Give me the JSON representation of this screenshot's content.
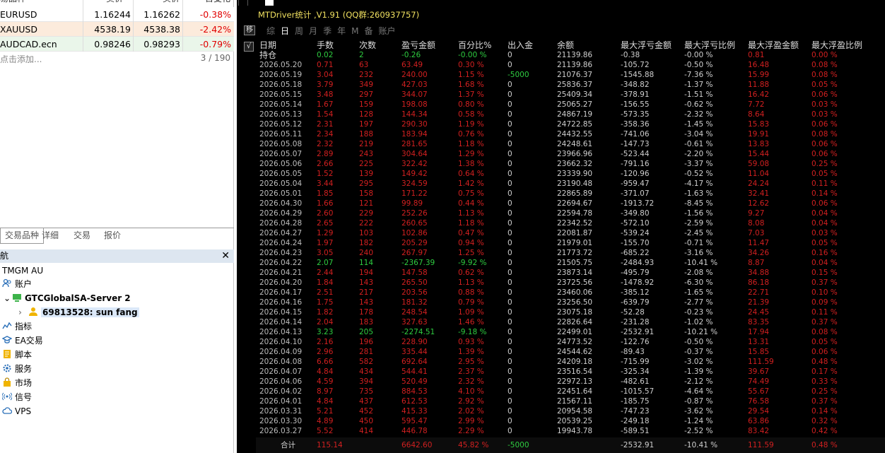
{
  "market_watch": {
    "rows": [
      {
        "symbol": "EURUSD",
        "bid": "1.16244",
        "ask": "1.16262",
        "change": "-0.38%"
      },
      {
        "symbol": "XAUUSD",
        "bid": "4538.19",
        "ask": "4538.38",
        "change": "-2.42%"
      },
      {
        "symbol": "AUDCAD.ecn",
        "bid": "0.98246",
        "ask": "0.98293",
        "change": "-0.79%"
      }
    ],
    "add_label": "点击添加...",
    "count": "3 / 190"
  },
  "tabs": [
    "交易品种",
    "详细",
    "交易",
    "报价"
  ],
  "navigator": {
    "title": "航",
    "broker": "TMGM AU",
    "accounts_label": "账户",
    "server": "GTCGlobalSA-Server 2",
    "account": "69813528: sun fang",
    "items": [
      "指标",
      "EA交易",
      "脚本",
      "服务",
      "市场",
      "信号",
      "VPS"
    ]
  },
  "panel": {
    "title": "MTDriver统计 ,V1.91 (QQ群:260937757)",
    "toolbar": [
      "综",
      "日",
      "周",
      "月",
      "季",
      "年",
      "M",
      "备",
      "账户"
    ],
    "active_index": 1,
    "side_buttons": [
      "移",
      "√"
    ],
    "headers": [
      "日期",
      "手数",
      "次数",
      "盈亏金额",
      "百分比%",
      "出入金",
      "余额",
      "最大浮亏金额",
      "最大浮亏比例",
      "最大浮盈金额",
      "最大浮盈比例"
    ],
    "holding": [
      "持仓",
      "0.02",
      "2",
      "-0.26",
      "-0.00 %",
      "0",
      "21139.86",
      "-0.38",
      "-0.00 %",
      "0.81",
      "0.00 %"
    ],
    "rows": [
      [
        "2026.05.20",
        "0.71",
        "63",
        "63.49",
        "0.30 %",
        "0",
        "21139.86",
        "-105.72",
        "-0.50 %",
        "16.48",
        "0.08 %"
      ],
      [
        "2026.05.19",
        "3.04",
        "232",
        "240.00",
        "1.15 %",
        "-5000",
        "21076.37",
        "-1545.88",
        "-7.36 %",
        "15.99",
        "0.08 %"
      ],
      [
        "2026.05.18",
        "3.79",
        "349",
        "427.03",
        "1.68 %",
        "0",
        "25836.37",
        "-348.82",
        "-1.37 %",
        "11.88",
        "0.05 %"
      ],
      [
        "2026.05.15",
        "3.48",
        "297",
        "344.07",
        "1.37 %",
        "0",
        "25409.34",
        "-378.91",
        "-1.51 %",
        "16.42",
        "0.06 %"
      ],
      [
        "2026.05.14",
        "1.67",
        "159",
        "198.08",
        "0.80 %",
        "0",
        "25065.27",
        "-156.55",
        "-0.62 %",
        "7.72",
        "0.03 %"
      ],
      [
        "2026.05.13",
        "1.54",
        "128",
        "144.34",
        "0.58 %",
        "0",
        "24867.19",
        "-573.35",
        "-2.32 %",
        "8.64",
        "0.03 %"
      ],
      [
        "2026.05.12",
        "2.31",
        "197",
        "290.30",
        "1.19 %",
        "0",
        "24722.85",
        "-358.36",
        "-1.45 %",
        "15.83",
        "0.06 %"
      ],
      [
        "2026.05.11",
        "2.34",
        "188",
        "183.94",
        "0.76 %",
        "0",
        "24432.55",
        "-741.06",
        "-3.04 %",
        "19.91",
        "0.08 %"
      ],
      [
        "2026.05.08",
        "2.32",
        "219",
        "281.65",
        "1.18 %",
        "0",
        "24248.61",
        "-147.73",
        "-0.61 %",
        "13.83",
        "0.06 %"
      ],
      [
        "2026.05.07",
        "2.89",
        "243",
        "304.64",
        "1.29 %",
        "0",
        "23966.96",
        "-523.44",
        "-2.20 %",
        "15.44",
        "0.06 %"
      ],
      [
        "2026.05.06",
        "2.66",
        "225",
        "322.42",
        "1.38 %",
        "0",
        "23662.32",
        "-791.16",
        "-3.37 %",
        "59.08",
        "0.25 %"
      ],
      [
        "2026.05.05",
        "1.52",
        "139",
        "149.42",
        "0.64 %",
        "0",
        "23339.90",
        "-120.96",
        "-0.52 %",
        "11.04",
        "0.05 %"
      ],
      [
        "2026.05.04",
        "3.44",
        "295",
        "324.59",
        "1.42 %",
        "0",
        "23190.48",
        "-959.47",
        "-4.17 %",
        "24.24",
        "0.11 %"
      ],
      [
        "2026.05.01",
        "1.85",
        "158",
        "171.22",
        "0.75 %",
        "0",
        "22865.89",
        "-371.07",
        "-1.63 %",
        "32.41",
        "0.14 %"
      ],
      [
        "2026.04.30",
        "1.66",
        "121",
        "99.89",
        "0.44 %",
        "0",
        "22694.67",
        "-1913.72",
        "-8.45 %",
        "12.62",
        "0.06 %"
      ],
      [
        "2026.04.29",
        "2.60",
        "229",
        "252.26",
        "1.13 %",
        "0",
        "22594.78",
        "-349.80",
        "-1.56 %",
        "9.27",
        "0.04 %"
      ],
      [
        "2026.04.28",
        "2.65",
        "222",
        "260.65",
        "1.18 %",
        "0",
        "22342.52",
        "-572.10",
        "-2.59 %",
        "8.08",
        "0.04 %"
      ],
      [
        "2026.04.27",
        "1.29",
        "103",
        "102.86",
        "0.47 %",
        "0",
        "22081.87",
        "-539.24",
        "-2.45 %",
        "7.03",
        "0.03 %"
      ],
      [
        "2026.04.24",
        "1.97",
        "182",
        "205.29",
        "0.94 %",
        "0",
        "21979.01",
        "-155.70",
        "-0.71 %",
        "11.47",
        "0.05 %"
      ],
      [
        "2026.04.23",
        "3.05",
        "240",
        "267.97",
        "1.25 %",
        "0",
        "21773.72",
        "-685.22",
        "-3.16 %",
        "34.26",
        "0.16 %"
      ],
      [
        "2026.04.22",
        "2.07",
        "114",
        "-2367.39",
        "-9.92 %",
        "0",
        "21505.75",
        "-2484.93",
        "-10.41 %",
        "8.87",
        "0.04 %"
      ],
      [
        "2026.04.21",
        "2.44",
        "194",
        "147.58",
        "0.62 %",
        "0",
        "23873.14",
        "-495.79",
        "-2.08 %",
        "34.88",
        "0.15 %"
      ],
      [
        "2026.04.20",
        "1.84",
        "143",
        "265.50",
        "1.13 %",
        "0",
        "23725.56",
        "-1478.92",
        "-6.30 %",
        "86.18",
        "0.37 %"
      ],
      [
        "2026.04.17",
        "2.51",
        "217",
        "203.56",
        "0.88 %",
        "0",
        "23460.06",
        "-385.12",
        "-1.65 %",
        "22.71",
        "0.10 %"
      ],
      [
        "2026.04.16",
        "1.75",
        "143",
        "181.32",
        "0.79 %",
        "0",
        "23256.50",
        "-639.79",
        "-2.77 %",
        "21.39",
        "0.09 %"
      ],
      [
        "2026.04.15",
        "1.82",
        "178",
        "248.54",
        "1.09 %",
        "0",
        "23075.18",
        "-52.28",
        "-0.23 %",
        "24.45",
        "0.11 %"
      ],
      [
        "2026.04.14",
        "2.04",
        "183",
        "327.63",
        "1.46 %",
        "0",
        "22826.64",
        "-231.28",
        "-1.02 %",
        "83.35",
        "0.37 %"
      ],
      [
        "2026.04.13",
        "3.23",
        "205",
        "-2274.51",
        "-9.18 %",
        "0",
        "22499.01",
        "-2532.91",
        "-10.21 %",
        "17.94",
        "0.08 %"
      ],
      [
        "2026.04.10",
        "2.16",
        "196",
        "228.90",
        "0.93 %",
        "0",
        "24773.52",
        "-122.76",
        "-0.50 %",
        "13.31",
        "0.05 %"
      ],
      [
        "2026.04.09",
        "2.96",
        "281",
        "335.44",
        "1.39 %",
        "0",
        "24544.62",
        "-89.43",
        "-0.37 %",
        "15.85",
        "0.06 %"
      ],
      [
        "2026.04.08",
        "6.66",
        "582",
        "692.64",
        "2.95 %",
        "0",
        "24209.18",
        "-715.99",
        "-3.02 %",
        "111.59",
        "0.48 %"
      ],
      [
        "2026.04.07",
        "4.84",
        "434",
        "544.41",
        "2.37 %",
        "0",
        "23516.54",
        "-325.34",
        "-1.39 %",
        "39.67",
        "0.17 %"
      ],
      [
        "2026.04.06",
        "4.59",
        "394",
        "520.49",
        "2.32 %",
        "0",
        "22972.13",
        "-482.61",
        "-2.12 %",
        "74.49",
        "0.33 %"
      ],
      [
        "2026.04.02",
        "8.97",
        "735",
        "884.53",
        "4.10 %",
        "0",
        "22451.64",
        "-1015.57",
        "-4.64 %",
        "55.67",
        "0.25 %"
      ],
      [
        "2026.04.01",
        "4.84",
        "437",
        "612.53",
        "2.92 %",
        "0",
        "21567.11",
        "-185.75",
        "-0.87 %",
        "76.58",
        "0.37 %"
      ],
      [
        "2026.03.31",
        "5.21",
        "452",
        "415.33",
        "2.02 %",
        "0",
        "20954.58",
        "-747.23",
        "-3.62 %",
        "29.54",
        "0.14 %"
      ],
      [
        "2026.03.30",
        "4.89",
        "450",
        "595.47",
        "2.99 %",
        "0",
        "20539.25",
        "-249.18",
        "-1.24 %",
        "63.86",
        "0.32 %"
      ],
      [
        "2026.03.27",
        "5.52",
        "414",
        "446.78",
        "2.29 %",
        "0",
        "19943.78",
        "-589.51",
        "-2.52 %",
        "83.42",
        "0.42 %"
      ]
    ],
    "totals": [
      "合计",
      "115.14",
      "",
      "6642.60",
      "45.82 %",
      "-5000",
      "",
      "-2532.91",
      "-10.41 %",
      "111.59",
      "0.48 %"
    ]
  }
}
